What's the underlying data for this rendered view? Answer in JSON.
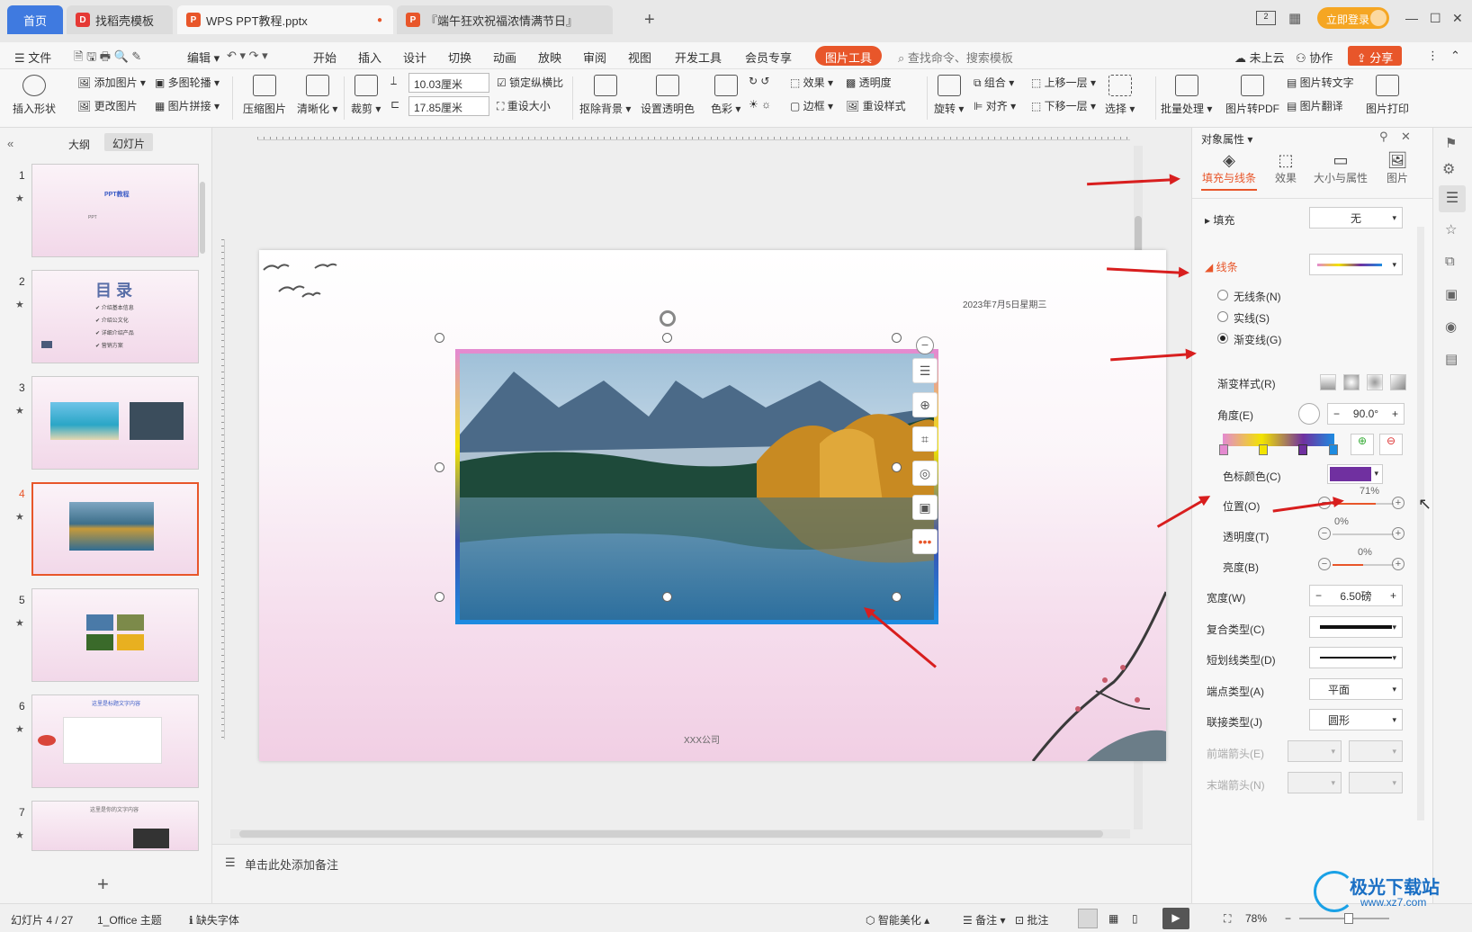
{
  "tabs": {
    "home": "首页",
    "template": "找稻壳模板",
    "doc": "WPS PPT教程.pptx",
    "doc2": "『端午狂欢祝福浓情满节日』",
    "login": "立即登录"
  },
  "menu": {
    "file": "文件",
    "edit": "编辑",
    "start": "开始",
    "insert": "插入",
    "design": "设计",
    "switch": "切换",
    "animation": "动画",
    "show": "放映",
    "review": "审阅",
    "view": "视图",
    "dev": "开发工具",
    "vip": "会员专享",
    "picture_tools": "图片工具",
    "search": "查找命令、搜索模板",
    "cloud": "未上云",
    "collab": "协作",
    "share": "分享"
  },
  "ribbon": {
    "insert_shape": "插入形状",
    "add_picture": "添加图片",
    "multi_carousel": "多图轮播",
    "change_picture": "更改图片",
    "picture_splice": "图片拼接",
    "compress": "压缩图片",
    "clarify": "清晰化",
    "crop": "裁剪",
    "height": "10.03厘米",
    "width": "17.85厘米",
    "lock_ratio": "锁定纵横比",
    "reset_size": "重设大小",
    "remove_bg": "抠除背景",
    "set_transparent": "设置透明色",
    "color": "色彩",
    "effect": "效果",
    "transparency": "透明度",
    "border": "边框",
    "reset_style": "重设样式",
    "rotate": "旋转",
    "group": "组合",
    "align": "对齐",
    "bring_forward": "上移一层",
    "send_backward": "下移一层",
    "select": "选择",
    "batch": "批量处理",
    "to_pdf": "图片转PDF",
    "to_text": "图片转文字",
    "translate": "图片翻译",
    "print": "图片打印"
  },
  "leftpanel": {
    "outline": "大纲",
    "slides": "幻灯片",
    "thumbs": [
      {
        "num": "1",
        "title": "PPT教程",
        "sub": "PPT"
      },
      {
        "num": "2",
        "title": "目 录",
        "items": [
          "介绍基本信息",
          "介绍公文化",
          "详细介绍产品",
          "营销方案"
        ]
      },
      {
        "num": "3"
      },
      {
        "num": "4"
      },
      {
        "num": "5"
      },
      {
        "num": "6",
        "title": "这里是标题文字内容"
      },
      {
        "num": "7",
        "title": "这里是你的文字内容"
      }
    ]
  },
  "slide": {
    "date": "2023年7月5日星期三",
    "company": "XXX公司"
  },
  "notes": "单击此处添加备注",
  "rightpanel": {
    "title": "对象属性",
    "tabs": [
      "填充与线条",
      "效果",
      "大小与属性",
      "图片"
    ],
    "fill": "填充",
    "fill_value": "无",
    "line": "线条",
    "no_line": "无线条(N)",
    "solid_line": "实线(S)",
    "gradient_line": "渐变线(G)",
    "gradient_style": "渐变样式(R)",
    "angle": "角度(E)",
    "angle_value": "90.0°",
    "stop_color": "色标颜色(C)",
    "position": "位置(O)",
    "position_value": "71%",
    "transparency": "透明度(T)",
    "transparency_value": "0%",
    "brightness": "亮度(B)",
    "brightness_value": "0%",
    "width": "宽度(W)",
    "width_value": "6.50磅",
    "compound": "复合类型(C)",
    "dash": "短划线类型(D)",
    "cap": "端点类型(A)",
    "cap_value": "平面",
    "join": "联接类型(J)",
    "join_value": "圆形",
    "begin_arrow": "前端箭头(E)",
    "end_arrow": "末端箭头(N)"
  },
  "status": {
    "slide": "幻灯片 4 / 27",
    "theme": "1_Office 主题",
    "font": "缺失字体",
    "beautify": "智能美化",
    "notes": "备注",
    "comments": "批注",
    "zoom": "78%"
  },
  "watermark": "极光下载站",
  "watermark_url": "www.xz7.com",
  "colors": {
    "accent": "#e8562a",
    "stop_color": "#7030a0"
  }
}
